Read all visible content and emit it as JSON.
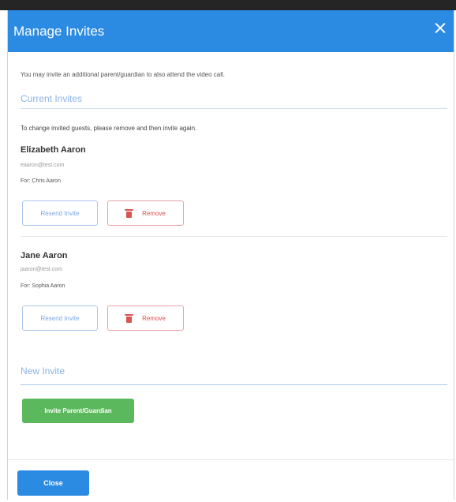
{
  "modal": {
    "title": "Manage Invites",
    "intro_text": "You may invite an additional parent/guardian to also attend the video call.",
    "close_label": "Close"
  },
  "current_invites": {
    "title": "Current Invites",
    "note": "To change invited guests, please remove and then invite again.",
    "guests": [
      {
        "name": "Elizabeth Aaron",
        "email": "eaaron@test.com",
        "for_text": "For: Chris Aaron",
        "resend_label": "Resend Invite",
        "remove_label": "Remove"
      },
      {
        "name": "Jane Aaron",
        "email": "jaaron@test.com",
        "for_text": "For: Sophia Aaron",
        "resend_label": "Resend Invite",
        "remove_label": "Remove"
      }
    ]
  },
  "new_invite": {
    "title": "New Invite",
    "invite_button_label": "Invite Parent/Guardian"
  },
  "colors": {
    "header": "#2b8ae2",
    "primary": "#2b8ae2",
    "success": "#5cb85c",
    "danger": "#d9534f"
  }
}
